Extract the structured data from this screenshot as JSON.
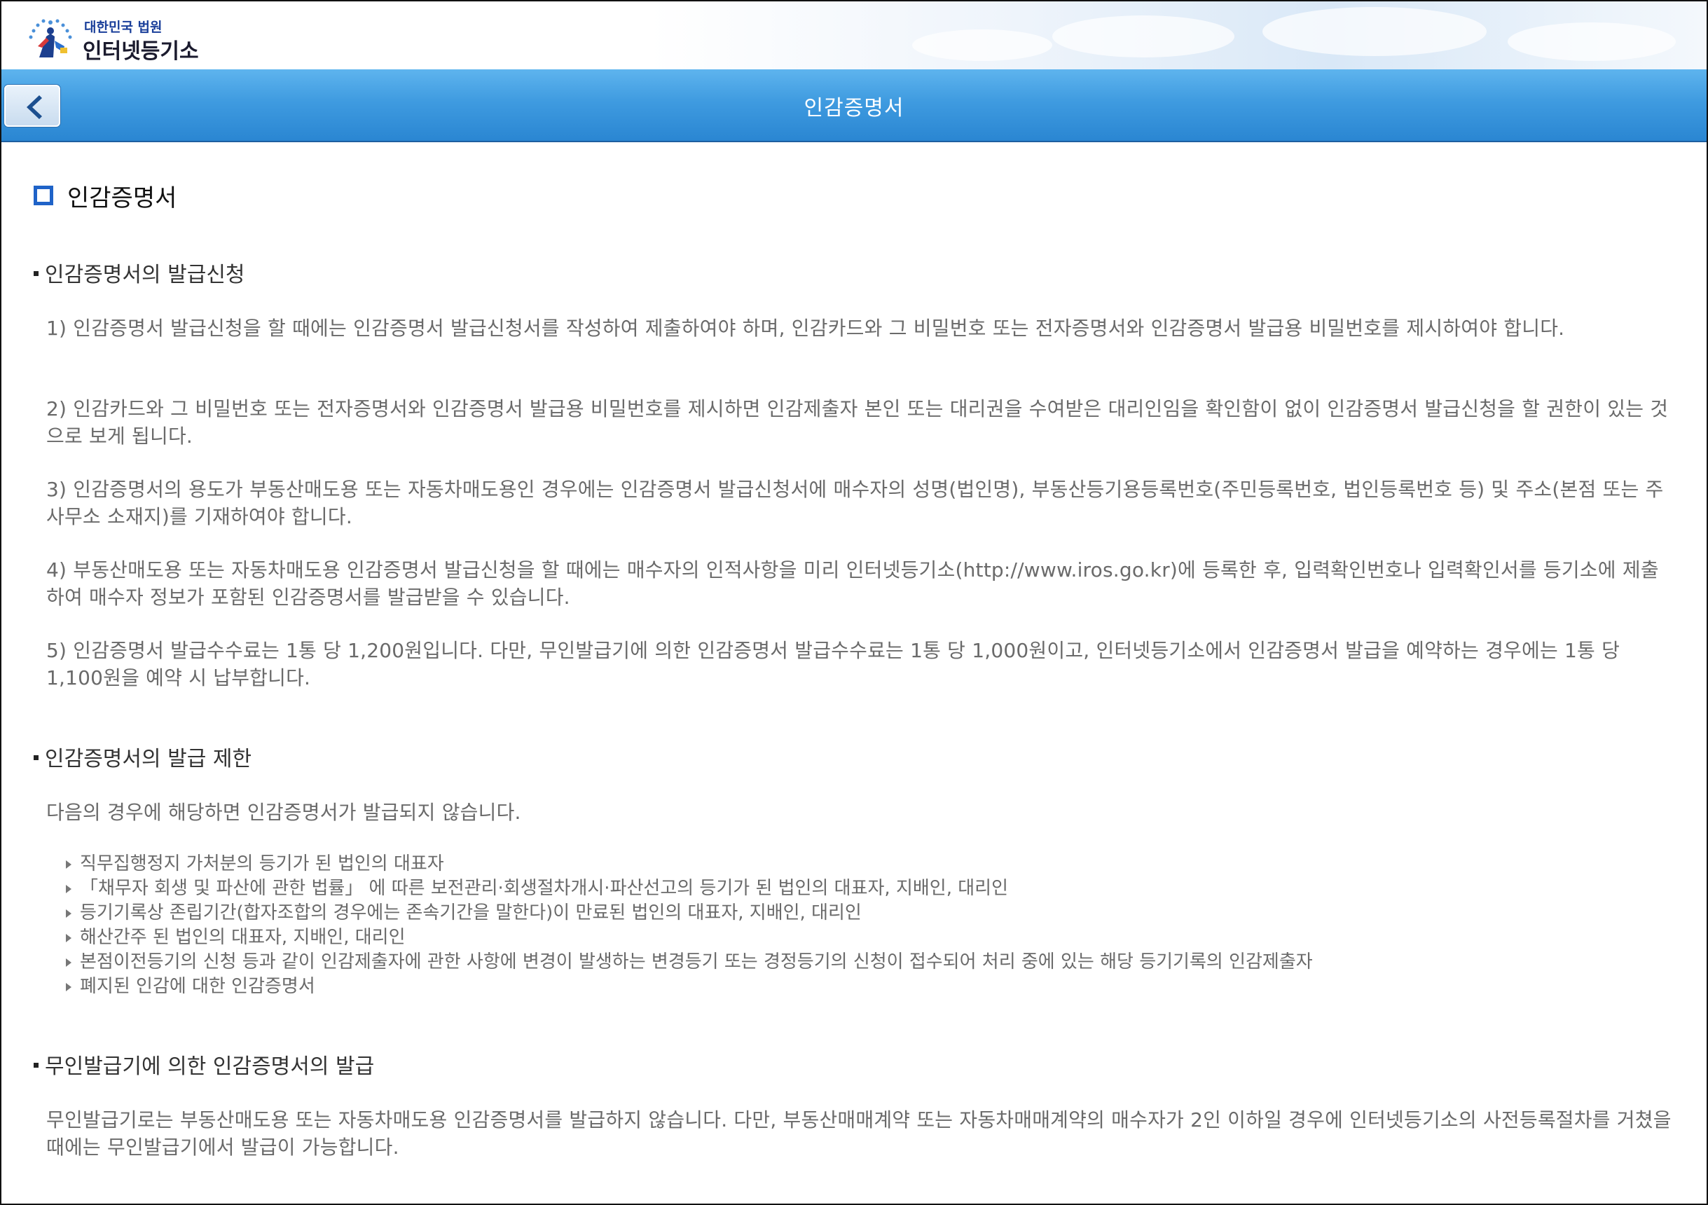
{
  "brand": {
    "subtitle": "대한민국 법원",
    "name": "인터넷등기소",
    "logo_icon": "court-emblem-icon"
  },
  "titlebar": {
    "title": "인감증명서",
    "back_icon": "chevron-left-icon"
  },
  "colors": {
    "title_bar": "#3f9be0",
    "heading_box": "#1f63c8",
    "body_text": "#6a6a6a"
  },
  "content": {
    "heading": "인감증명서",
    "section1": {
      "title": "인감증명서의 발급신청",
      "paragraphs": [
        "1) 인감증명서 발급신청을 할 때에는 인감증명서 발급신청서를 작성하여 제출하여야 하며, 인감카드와 그 비밀번호 또는 전자증명서와 인감증명서 발급용 비밀번호를 제시하여야 합니다.",
        "2) 인감카드와 그 비밀번호 또는 전자증명서와 인감증명서 발급용 비밀번호를 제시하면 인감제출자 본인 또는 대리권을 수여받은 대리인임을 확인함이 없이 인감증명서 발급신청을 할 권한이 있는 것으로 보게 됩니다.",
        "3) 인감증명서의 용도가 부동산매도용 또는 자동차매도용인 경우에는 인감증명서 발급신청서에 매수자의 성명(법인명), 부동산등기용등록번호(주민등록번호, 법인등록번호 등) 및 주소(본점 또는 주사무소 소재지)를 기재하여야 합니다.",
        "4) 부동산매도용 또는 자동차매도용 인감증명서 발급신청을 할 때에는 매수자의 인적사항을 미리 인터넷등기소(http://www.iros.go.kr)에 등록한 후, 입력확인번호나 입력확인서를 등기소에 제출하여 매수자 정보가 포함된 인감증명서를 발급받을 수 있습니다.",
        "5) 인감증명서 발급수수료는 1통 당 1,200원입니다. 다만, 무인발급기에 의한 인감증명서 발급수수료는 1통 당 1,000원이고, 인터넷등기소에서 인감증명서 발급을 예약하는 경우에는 1통 당 1,100원을 예약 시 납부합니다."
      ]
    },
    "section2": {
      "title": "인감증명서의 발급 제한",
      "intro": "다음의 경우에 해당하면 인감증명서가 발급되지 않습니다.",
      "items": [
        "직무집행정지 가처분의 등기가 된 법인의 대표자",
        "「채무자 회생 및 파산에 관한 법률」 에 따른 보전관리·회생절차개시·파산선고의 등기가 된 법인의 대표자, 지배인, 대리인",
        "등기기록상 존립기간(합자조합의 경우에는 존속기간을 말한다)이 만료된 법인의 대표자, 지배인, 대리인",
        "해산간주 된 법인의 대표자, 지배인, 대리인",
        "본점이전등기의 신청 등과 같이 인감제출자에 관한 사항에 변경이 발생하는 변경등기 또는 경정등기의 신청이 접수되어 처리 중에 있는 해당 등기기록의 인감제출자",
        "폐지된 인감에 대한 인감증명서"
      ]
    },
    "section3": {
      "title": "무인발급기에 의한 인감증명서의 발급",
      "paragraph": "무인발급기로는 부동산매도용 또는 자동차매도용 인감증명서를 발급하지 않습니다. 다만, 부동산매매계약 또는 자동차매매계약의 매수자가 2인 이하일 경우에 인터넷등기소의 사전등록절차를 거쳤을 때에는 무인발급기에서 발급이 가능합니다."
    }
  }
}
